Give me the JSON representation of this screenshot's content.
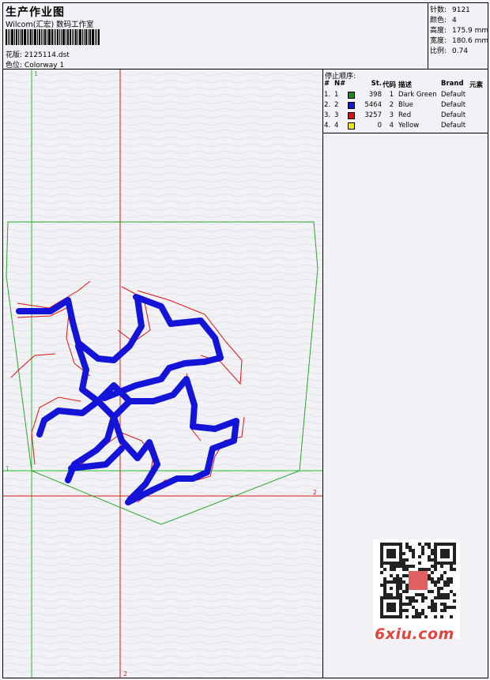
{
  "header": {
    "title": "生产作业图",
    "company": "Wilcom(汇宏) 数码工作室",
    "design_label": "花版:",
    "design_value": "2125114.dst",
    "colorway_label": "色位:",
    "colorway_value": "Colorway 1"
  },
  "info": [
    {
      "label": "针数:",
      "value": "9121"
    },
    {
      "label": "颜色:",
      "value": "4"
    },
    {
      "label": "高度:",
      "value": "175.9 mm"
    },
    {
      "label": "宽度:",
      "value": "180.6 mm"
    },
    {
      "label": "比例:",
      "value": "0.74"
    }
  ],
  "stop_sequence": {
    "title": "停止顺序:",
    "headers": {
      "no": "#",
      "n": "N#",
      "st": "St.",
      "code": "代码",
      "desc": "描述",
      "brand": "Brand",
      "elem": "元素"
    },
    "rows": [
      {
        "no": "1.",
        "n": "1",
        "color": "#1a8a1a",
        "st": "398",
        "code": "1",
        "desc": "Dark Green",
        "brand": "Default"
      },
      {
        "no": "2.",
        "n": "2",
        "color": "#1414d8",
        "st": "5464",
        "code": "2",
        "desc": "Blue",
        "brand": "Default"
      },
      {
        "no": "3.",
        "n": "3",
        "color": "#e01010",
        "st": "3257",
        "code": "3",
        "desc": "Red",
        "brand": "Default"
      },
      {
        "no": "4.",
        "n": "4",
        "color": "#f5e800",
        "st": "0",
        "code": "4",
        "desc": "Yellow",
        "brand": "Default"
      }
    ]
  },
  "guides": {
    "green_v": "1",
    "green_h": "1",
    "red_v": "2",
    "red_h": "2"
  },
  "colors": {
    "green_guide": "#22c022",
    "red_guide": "#d81818",
    "outline": "#2aa52a",
    "blue": "#1414d8",
    "red": "#e01010"
  },
  "watermark": "6xiu.com"
}
